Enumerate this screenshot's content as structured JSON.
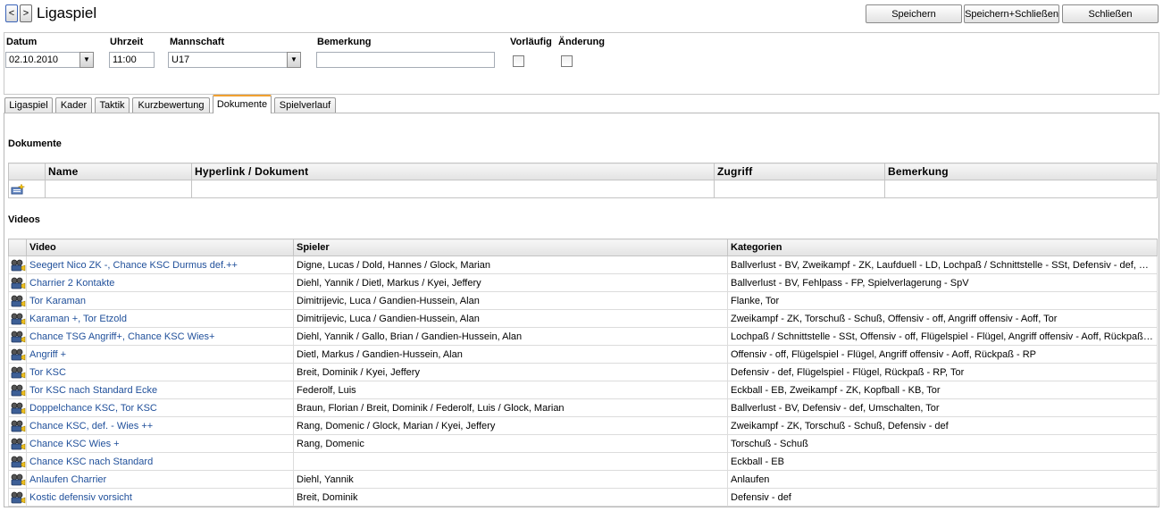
{
  "header": {
    "prev_label": "<",
    "next_label": ">",
    "title": "Ligaspiel",
    "buttons": {
      "save": "Speichern",
      "save_close": "Speichern+Schließen",
      "close": "Schließen"
    }
  },
  "form": {
    "datum_label": "Datum",
    "datum_value": "02.10.2010",
    "uhrzeit_label": "Uhrzeit",
    "uhrzeit_value": "11:00",
    "mannschaft_label": "Mannschaft",
    "mannschaft_value": "U17",
    "bemerkung_label": "Bemerkung",
    "bemerkung_value": "",
    "vorlaeufig_label": "Vorläufig",
    "aenderung_label": "Änderung"
  },
  "tabs": [
    {
      "label": "Ligaspiel"
    },
    {
      "label": "Kader"
    },
    {
      "label": "Taktik"
    },
    {
      "label": "Kurzbewertung"
    },
    {
      "label": "Dokumente"
    },
    {
      "label": "Spielverlauf"
    }
  ],
  "active_tab": "Dokumente",
  "documents": {
    "section_title": "Dokumente",
    "columns": [
      "Name",
      "Hyperlink / Dokument",
      "Zugriff",
      "Bemerkung"
    ]
  },
  "videos": {
    "section_title": "Videos",
    "columns": [
      "Video",
      "Spieler",
      "Kategorien"
    ],
    "rows": [
      {
        "video": "Seegert Nico ZK -, Chance KSC Durmus def.++",
        "spieler": "Digne, Lucas / Dold, Hannes / Glock, Marian",
        "kategorien": "Ballverlust - BV, Zweikampf - ZK, Laufduell - LD, Lochpaß / Schnittstelle - SSt, Defensiv - def, Um..."
      },
      {
        "video": "Charrier 2 Kontakte",
        "spieler": "Diehl, Yannik / Dietl, Markus / Kyei, Jeffery",
        "kategorien": "Ballverlust - BV, Fehlpass - FP, Spielverlagerung - SpV"
      },
      {
        "video": "Tor Karaman",
        "spieler": "Dimitrijevic, Luca / Gandien-Hussein, Alan",
        "kategorien": "Flanke, Tor"
      },
      {
        "video": "Karaman +, Tor Etzold",
        "spieler": "Dimitrijevic, Luca / Gandien-Hussein, Alan",
        "kategorien": "Zweikampf - ZK, Torschuß - Schuß, Offensiv - off, Angriff offensiv - Aoff, Tor"
      },
      {
        "video": "Chance TSG Angriff+, Chance KSC Wies+",
        "spieler": "Diehl, Yannik / Gallo, Brian / Gandien-Hussein, Alan",
        "kategorien": "Lochpaß / Schnittstelle - SSt, Offensiv - off, Flügelspiel - Flügel, Angriff offensiv - Aoff, Rückpaß ..."
      },
      {
        "video": "Angriff +",
        "spieler": "Dietl, Markus / Gandien-Hussein, Alan",
        "kategorien": "Offensiv - off, Flügelspiel - Flügel, Angriff offensiv - Aoff, Rückpaß - RP"
      },
      {
        "video": "Tor KSC",
        "spieler": "Breit, Dominik / Kyei, Jeffery",
        "kategorien": "Defensiv - def, Flügelspiel - Flügel, Rückpaß - RP, Tor"
      },
      {
        "video": "Tor KSC nach Standard Ecke",
        "spieler": "Federolf, Luis",
        "kategorien": "Eckball - EB, Zweikampf - ZK, Kopfball - KB, Tor"
      },
      {
        "video": "Doppelchance KSC, Tor KSC",
        "spieler": "Braun, Florian / Breit, Dominik / Federolf, Luis / Glock, Marian",
        "kategorien": "Ballverlust - BV, Defensiv - def, Umschalten, Tor"
      },
      {
        "video": "Chance KSC, def. - Wies ++",
        "spieler": "Rang, Domenic / Glock, Marian / Kyei, Jeffery",
        "kategorien": "Zweikampf - ZK, Torschuß - Schuß, Defensiv - def"
      },
      {
        "video": "Chance KSC Wies +",
        "spieler": "Rang, Domenic",
        "kategorien": "Torschuß - Schuß"
      },
      {
        "video": "Chance KSC nach Standard",
        "spieler": "",
        "kategorien": "Eckball - EB"
      },
      {
        "video": "Anlaufen Charrier",
        "spieler": "Diehl, Yannik",
        "kategorien": "Anlaufen"
      },
      {
        "video": "Kostic defensiv vorsicht",
        "spieler": "Breit, Dominik",
        "kategorien": "Defensiv - def"
      }
    ]
  }
}
